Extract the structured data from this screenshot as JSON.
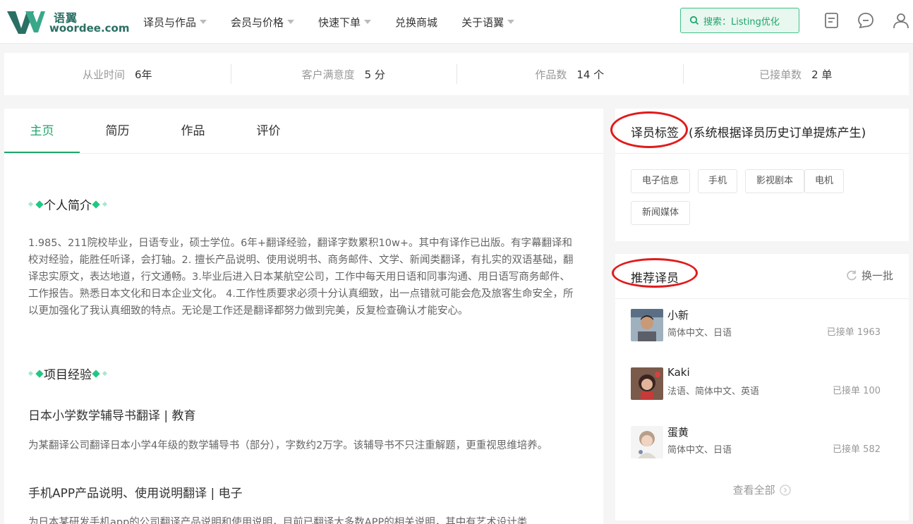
{
  "brand": {
    "name_cn": "语翼",
    "name_en": "woordee.com",
    "color": "#2a6f64",
    "accent": "#1fa56c"
  },
  "nav": [
    {
      "label": "译员与作品",
      "dropdown": true
    },
    {
      "label": "会员与价格",
      "dropdown": true
    },
    {
      "label": "快速下单",
      "dropdown": true
    },
    {
      "label": "兑换商城",
      "dropdown": false
    },
    {
      "label": "关于语翼",
      "dropdown": true
    }
  ],
  "search": {
    "label": "搜索：Listing优化",
    "icon": "search-icon"
  },
  "header_icons": [
    "document-icon",
    "message-icon",
    "user-icon"
  ],
  "stats": [
    {
      "label": "从业时间",
      "value": "6年"
    },
    {
      "label": "客户满意度",
      "value": "5 分"
    },
    {
      "label": "作品数",
      "value": "14 个"
    },
    {
      "label": "已接单数",
      "value": "2 单"
    }
  ],
  "tabs": [
    {
      "label": "主页",
      "active": true
    },
    {
      "label": "简历",
      "active": false
    },
    {
      "label": "作品",
      "active": false
    },
    {
      "label": "评价",
      "active": false
    }
  ],
  "intro": {
    "title": "个人简介",
    "text": "1.985、211院校毕业，日语专业，硕士学位。6年+翻译经验，翻译字数累积10w+。其中有译作已出版。有字幕翻译和校对经验，能胜任听译，会打轴。2. 擅长产品说明、使用说明书、商务邮件、文学、新闻类翻译，有扎实的双语基础，翻译忠实原文，表达地道，行文通畅。3.毕业后进入日本某航空公司，工作中每天用日语和同事沟通、用日语写商务邮件、工作报告。熟悉日本文化和日本企业文化。 4.工作性质要求必须十分认真细致，出一点错就可能会危及旅客生命安全，所以更加强化了我认真细致的特点。无论是工作还是翻译都努力做到完美，反复检查确认才能安心。"
  },
  "projects": {
    "title": "项目经验",
    "items": [
      {
        "title": "日本小学数学辅导书翻译 | 教育",
        "desc": "为某翻译公司翻译日本小学4年级的数学辅导书（部分），字数约2万字。该辅导书不只注重解题，更重视思维培养。"
      },
      {
        "title": "手机APP产品说明、使用说明翻译 | 电子",
        "desc": "为日本某研发手机app的公司翻译产品说明和使用说明，目前已翻译大多数APP的相关说明，其中有艺术设计类"
      }
    ]
  },
  "translator_tags": {
    "title": "译员标签",
    "subtitle": "(系统根据译员历史订单提炼产生)",
    "tags": [
      "电子信息",
      "手机",
      "影视剧本",
      "电机",
      "新闻媒体"
    ]
  },
  "recommended": {
    "title": "推荐译员",
    "refresh_label": "换一批",
    "translators": [
      {
        "name": "小新",
        "langs": "简体中文、日语",
        "orders": "已接单 1963"
      },
      {
        "name": "Kaki",
        "langs": "法语、简体中文、英语",
        "orders": "已接单 100"
      },
      {
        "name": "蛋黄",
        "langs": "简体中文、日语",
        "orders": "已接单 582"
      }
    ],
    "view_all": "查看全部"
  }
}
